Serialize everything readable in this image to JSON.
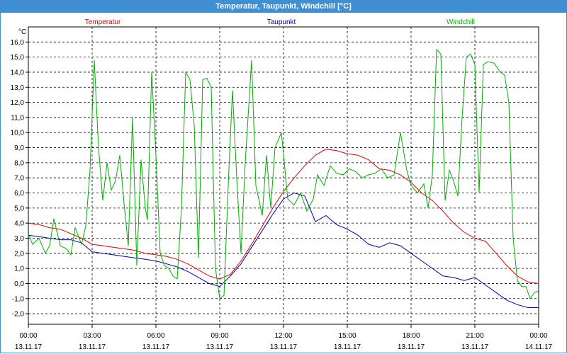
{
  "window": {
    "title": "Temperatur, Taupunkt, Windchill [°C]"
  },
  "chart_data": {
    "type": "line",
    "title": "Temperatur, Taupunkt, Windchill [°C]",
    "ylabel": "°C",
    "ylim": [
      -2.7,
      17.0
    ],
    "xlim": [
      0,
      24
    ],
    "grid": true,
    "yticks": [
      -2.0,
      -1.0,
      0.0,
      1.0,
      2.0,
      3.0,
      4.0,
      5.0,
      6.0,
      7.0,
      8.0,
      9.0,
      10.0,
      11.0,
      12.0,
      13.0,
      14.0,
      15.0,
      16.0
    ],
    "ytick_labels": [
      "-2,0",
      "-1,0",
      "0,0",
      "1,0",
      "2,0",
      "3,0",
      "4,0",
      "5,0",
      "6,0",
      "7,0",
      "8,0",
      "9,0",
      "10,0",
      "11,0",
      "12,0",
      "13,0",
      "14,0",
      "15,0",
      "16,0"
    ],
    "xticks": [
      {
        "time": "00:00",
        "date": "13.11.17"
      },
      {
        "time": "03:00",
        "date": "13.11.17"
      },
      {
        "time": "06:00",
        "date": "13.11.17"
      },
      {
        "time": "09:00",
        "date": "13.11.17"
      },
      {
        "time": "12:00",
        "date": "13.11.17"
      },
      {
        "time": "15:00",
        "date": "13.11.17"
      },
      {
        "time": "18:00",
        "date": "13.11.17"
      },
      {
        "time": "21:00",
        "date": "13.11.17"
      },
      {
        "time": "00:00",
        "date": "14.11.17"
      }
    ],
    "x_unit": "hours",
    "series": [
      {
        "name": "Temperatur",
        "color": "#e00000",
        "points": [
          [
            0,
            4.0
          ],
          [
            0.5,
            3.9
          ],
          [
            1.0,
            3.7
          ],
          [
            1.5,
            3.6
          ],
          [
            2.0,
            3.3
          ],
          [
            2.5,
            3.0
          ],
          [
            3.0,
            2.6
          ],
          [
            3.5,
            2.5
          ],
          [
            4.0,
            2.4
          ],
          [
            4.5,
            2.3
          ],
          [
            5.0,
            2.2
          ],
          [
            5.5,
            2.0
          ],
          [
            6.0,
            1.9
          ],
          [
            6.5,
            1.8
          ],
          [
            7.0,
            1.6
          ],
          [
            7.5,
            1.3
          ],
          [
            8.0,
            0.9
          ],
          [
            8.5,
            0.5
          ],
          [
            9.0,
            0.3
          ],
          [
            9.5,
            0.6
          ],
          [
            10.0,
            1.5
          ],
          [
            10.5,
            2.6
          ],
          [
            11.0,
            3.8
          ],
          [
            11.5,
            5.0
          ],
          [
            12.0,
            6.1
          ],
          [
            12.5,
            7.0
          ],
          [
            13.0,
            7.8
          ],
          [
            13.5,
            8.5
          ],
          [
            14.0,
            8.9
          ],
          [
            14.5,
            8.8
          ],
          [
            15.0,
            8.6
          ],
          [
            15.5,
            8.5
          ],
          [
            16.0,
            8.2
          ],
          [
            16.5,
            7.6
          ],
          [
            17.0,
            7.5
          ],
          [
            17.5,
            7.2
          ],
          [
            18.0,
            6.7
          ],
          [
            18.5,
            6.0
          ],
          [
            19.0,
            5.5
          ],
          [
            19.5,
            4.8
          ],
          [
            20.0,
            4.0
          ],
          [
            20.5,
            3.4
          ],
          [
            21.0,
            3.0
          ],
          [
            21.5,
            2.8
          ],
          [
            22.0,
            2.0
          ],
          [
            22.5,
            1.2
          ],
          [
            23.0,
            0.5
          ],
          [
            23.5,
            0.1
          ],
          [
            24.0,
            0.0
          ]
        ]
      },
      {
        "name": "Taupunkt",
        "color": "#0000b0",
        "points": [
          [
            0,
            3.2
          ],
          [
            0.5,
            3.1
          ],
          [
            1.0,
            3.0
          ],
          [
            1.5,
            2.9
          ],
          [
            2.0,
            2.9
          ],
          [
            2.5,
            2.7
          ],
          [
            3.0,
            2.1
          ],
          [
            3.5,
            2.0
          ],
          [
            4.0,
            1.9
          ],
          [
            4.5,
            1.8
          ],
          [
            5.0,
            1.7
          ],
          [
            5.5,
            1.6
          ],
          [
            6.0,
            1.5
          ],
          [
            6.5,
            1.3
          ],
          [
            7.0,
            1.1
          ],
          [
            7.5,
            0.8
          ],
          [
            8.0,
            0.4
          ],
          [
            8.5,
            0.0
          ],
          [
            9.0,
            -0.2
          ],
          [
            9.5,
            0.5
          ],
          [
            10.0,
            1.3
          ],
          [
            10.5,
            2.4
          ],
          [
            11.0,
            3.5
          ],
          [
            11.5,
            4.6
          ],
          [
            12.0,
            5.6
          ],
          [
            12.5,
            6.0
          ],
          [
            13.0,
            5.8
          ],
          [
            13.5,
            4.1
          ],
          [
            14.0,
            4.5
          ],
          [
            14.5,
            3.9
          ],
          [
            15.0,
            3.6
          ],
          [
            15.5,
            3.2
          ],
          [
            16.0,
            2.6
          ],
          [
            16.5,
            2.4
          ],
          [
            17.0,
            2.7
          ],
          [
            17.5,
            2.5
          ],
          [
            18.0,
            2.0
          ],
          [
            18.5,
            1.5
          ],
          [
            19.0,
            1.0
          ],
          [
            19.5,
            0.5
          ],
          [
            20.0,
            0.4
          ],
          [
            20.5,
            0.2
          ],
          [
            21.0,
            0.4
          ],
          [
            21.5,
            -0.1
          ],
          [
            22.0,
            -0.6
          ],
          [
            22.5,
            -1.1
          ],
          [
            23.0,
            -1.4
          ],
          [
            23.5,
            -1.6
          ],
          [
            24.0,
            -1.6
          ]
        ]
      },
      {
        "name": "Windchill",
        "color": "#00b000",
        "points": [
          [
            0,
            3.3
          ],
          [
            0.2,
            2.6
          ],
          [
            0.5,
            3.0
          ],
          [
            0.8,
            2.0
          ],
          [
            1.0,
            2.5
          ],
          [
            1.2,
            4.3
          ],
          [
            1.5,
            2.5
          ],
          [
            1.8,
            2.3
          ],
          [
            2.0,
            1.9
          ],
          [
            2.2,
            3.7
          ],
          [
            2.5,
            2.6
          ],
          [
            2.7,
            3.8
          ],
          [
            2.9,
            7.5
          ],
          [
            3.1,
            14.8
          ],
          [
            3.3,
            9.0
          ],
          [
            3.5,
            5.5
          ],
          [
            3.7,
            8.0
          ],
          [
            3.9,
            6.2
          ],
          [
            4.1,
            6.8
          ],
          [
            4.3,
            8.5
          ],
          [
            4.5,
            5.3
          ],
          [
            4.7,
            2.5
          ],
          [
            4.9,
            11.0
          ],
          [
            5.1,
            1.2
          ],
          [
            5.3,
            8.2
          ],
          [
            5.5,
            5.0
          ],
          [
            5.6,
            4.2
          ],
          [
            5.8,
            14.0
          ],
          [
            6.0,
            8.5
          ],
          [
            6.2,
            2.0
          ],
          [
            6.4,
            1.2
          ],
          [
            6.6,
            1.0
          ],
          [
            6.8,
            0.5
          ],
          [
            7.0,
            0.3
          ],
          [
            7.2,
            5.0
          ],
          [
            7.4,
            14.0
          ],
          [
            7.6,
            13.5
          ],
          [
            7.8,
            10.5
          ],
          [
            8.0,
            1.7
          ],
          [
            8.2,
            13.5
          ],
          [
            8.4,
            13.6
          ],
          [
            8.6,
            13.0
          ],
          [
            8.8,
            1.0
          ],
          [
            9.0,
            -1.0
          ],
          [
            9.2,
            -0.8
          ],
          [
            9.4,
            6.5
          ],
          [
            9.6,
            12.8
          ],
          [
            9.8,
            7.0
          ],
          [
            10.0,
            2.0
          ],
          [
            10.2,
            8.0
          ],
          [
            10.5,
            14.8
          ],
          [
            10.7,
            6.5
          ],
          [
            11.0,
            4.5
          ],
          [
            11.2,
            8.5
          ],
          [
            11.4,
            5.0
          ],
          [
            11.6,
            9.0
          ],
          [
            11.9,
            10.0
          ],
          [
            12.2,
            5.6
          ],
          [
            12.5,
            5.2
          ],
          [
            12.8,
            6.0
          ],
          [
            13.1,
            4.8
          ],
          [
            13.4,
            5.6
          ],
          [
            13.6,
            7.2
          ],
          [
            13.9,
            6.5
          ],
          [
            14.2,
            7.8
          ],
          [
            14.5,
            7.3
          ],
          [
            14.8,
            7.2
          ],
          [
            15.1,
            7.6
          ],
          [
            15.4,
            7.4
          ],
          [
            15.7,
            7.0
          ],
          [
            16.0,
            7.2
          ],
          [
            16.3,
            7.3
          ],
          [
            16.6,
            7.6
          ],
          [
            16.9,
            7.0
          ],
          [
            17.2,
            7.2
          ],
          [
            17.5,
            10.0
          ],
          [
            17.8,
            7.5
          ],
          [
            18.0,
            6.5
          ],
          [
            18.3,
            6.0
          ],
          [
            18.6,
            6.6
          ],
          [
            18.8,
            5.0
          ],
          [
            19.0,
            7.2
          ],
          [
            19.2,
            15.5
          ],
          [
            19.4,
            15.2
          ],
          [
            19.6,
            5.5
          ],
          [
            19.8,
            7.5
          ],
          [
            20.0,
            6.8
          ],
          [
            20.2,
            5.8
          ],
          [
            20.4,
            11.0
          ],
          [
            20.6,
            15.0
          ],
          [
            20.8,
            15.2
          ],
          [
            21.0,
            14.5
          ],
          [
            21.2,
            6.0
          ],
          [
            21.4,
            14.5
          ],
          [
            21.6,
            14.7
          ],
          [
            21.9,
            14.6
          ],
          [
            22.2,
            14.0
          ],
          [
            22.4,
            13.8
          ],
          [
            22.6,
            12.0
          ],
          [
            22.8,
            3.0
          ],
          [
            23.0,
            0.2
          ],
          [
            23.2,
            -0.2
          ],
          [
            23.4,
            -0.2
          ],
          [
            23.6,
            -1.0
          ],
          [
            23.8,
            -0.6
          ],
          [
            24.0,
            -0.5
          ]
        ]
      }
    ]
  }
}
